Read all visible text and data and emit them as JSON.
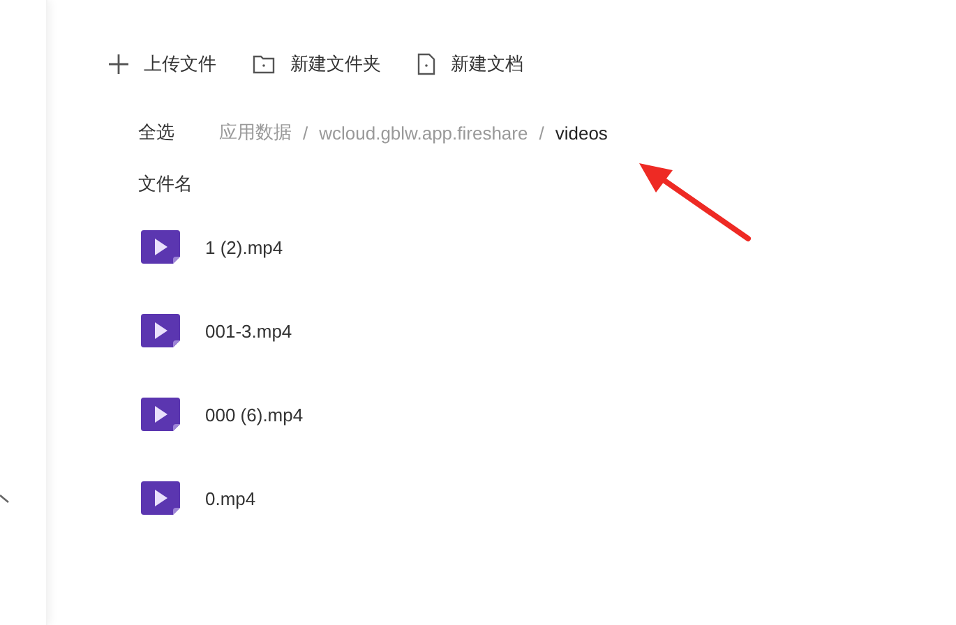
{
  "toolbar": [
    {
      "kind": "upload",
      "label": "上传文件"
    },
    {
      "kind": "folder",
      "label": "新建文件夹"
    },
    {
      "kind": "doc",
      "label": "新建文档"
    }
  ],
  "select_all": "全选",
  "breadcrumb": [
    {
      "label": "应用数据",
      "current": false
    },
    {
      "label": "wcloud.gblw.app.fireshare",
      "current": false
    },
    {
      "label": "videos",
      "current": true
    }
  ],
  "breadcrumb_separator": "/",
  "column_header": "文件名",
  "files": [
    {
      "name": "1 (2).mp4"
    },
    {
      "name": "001-3.mp4"
    },
    {
      "name": "000 (6).mp4"
    },
    {
      "name": "0.mp4"
    }
  ]
}
